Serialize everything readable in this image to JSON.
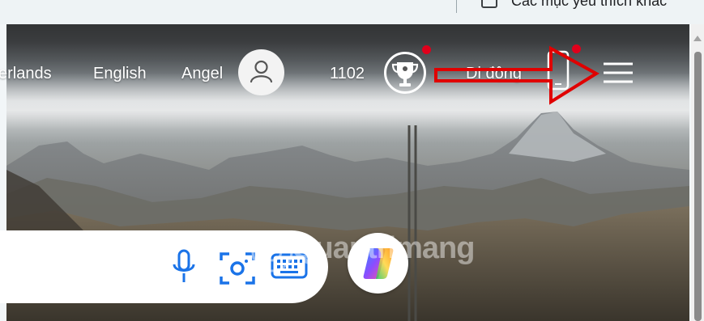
{
  "bookmarks_bar": {
    "other_favorites_label": "Các mục yêu thích khác"
  },
  "header": {
    "region": "erlands",
    "language": "English",
    "user_name": "Angel",
    "rewards_points": "1102",
    "mobile_label": "Di động"
  },
  "search": {
    "placeholder": ""
  },
  "watermark": {
    "text": "Quantrimang"
  },
  "colors": {
    "notification_dot": "#e0001b",
    "annotation_arrow": "#e00000",
    "search_icons": "#1a73e8"
  }
}
